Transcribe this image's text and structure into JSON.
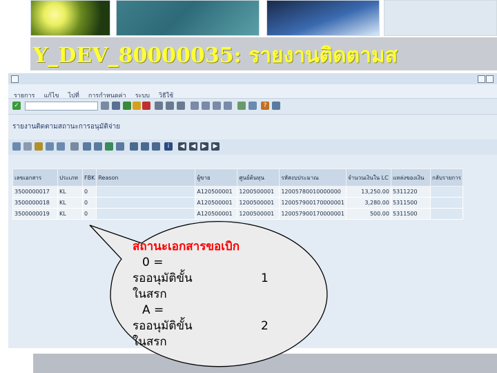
{
  "slide": {
    "title": "Y_DEV_80000035: รายงานติดตามส"
  },
  "sap": {
    "menu": [
      "รายการ",
      "แก้ไข",
      "ไปที่",
      "การกำหนดค่า",
      "ระบบ",
      "วิธีใช้"
    ],
    "command_field": "",
    "app_title": "รายงานติดตามสถานะการอนุมัติจ่าย",
    "grid": {
      "columns": [
        "เลขเอกสาร",
        "ประเภท",
        "FBK",
        "Reason",
        "ผู้ขาย",
        "ศูนย์ต้นทุน",
        "รหัสงบประมาณ",
        "จำนวนเงินใน LC",
        "แหล่งของเงิน",
        "กลับรายการ"
      ],
      "rows": [
        [
          "3500000017",
          "KL",
          "0",
          "",
          "A120500001",
          "1200500001",
          "12005780010000000",
          "13,250.00",
          "5311220",
          ""
        ],
        [
          "3500000018",
          "KL",
          "0",
          "",
          "A120500001",
          "1200500001",
          "120057900170000001",
          "3,280.00",
          "5311500",
          ""
        ],
        [
          "3500000019",
          "KL",
          "0",
          "",
          "A120500001",
          "1200500001",
          "120057900170000001",
          "500.00",
          "5311500",
          ""
        ]
      ]
    }
  },
  "callout": {
    "heading": "สถานะเอกสารขอเบิก",
    "lines": [
      {
        "text": "0 =",
        "num": ""
      },
      {
        "text": "รออนุมัติขั้น",
        "num": "1"
      },
      {
        "text": "ในสรก",
        "num": ""
      },
      {
        "text": "A =",
        "num": ""
      },
      {
        "text": "รออนุมัติขั้น",
        "num": "2"
      },
      {
        "text": "ในสรก",
        "num": ""
      }
    ]
  }
}
